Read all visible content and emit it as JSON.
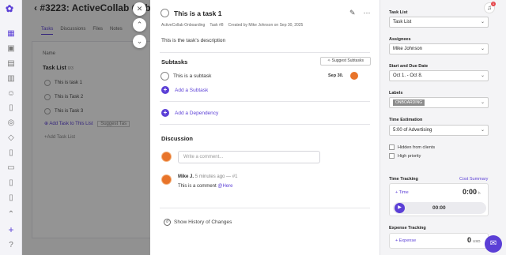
{
  "project": {
    "breadcrumb": "#3223: ActiveCollab Onb",
    "tabs": [
      "Tasks",
      "Discussions",
      "Files",
      "Notes"
    ],
    "list_header": "Name",
    "task_list_title": "Task List",
    "task_list_count": "0/3",
    "tasks": [
      "This is task 1",
      "This is Task 2",
      "This is Task 3"
    ],
    "add_task": "Add Task to This List",
    "suggest": "Suggest Tas",
    "add_task_list": "+Add Task List"
  },
  "task": {
    "title": "This is a task 1",
    "project": "ActiveCollab Onboarding",
    "number": "Task #8",
    "created": "Created by Mike Johnson on Sep 30, 2025",
    "description": "This is the task's description",
    "subtasks_heading": "Subtasks",
    "suggest_subtasks": "Suggest Subtasks",
    "subtask": {
      "label": "This is a subtask",
      "date": "Sep 30."
    },
    "add_subtask": "Add a Subtask",
    "add_dependency": "Add a Dependency",
    "discussion_heading": "Discussion",
    "comment_placeholder": "Write a comment...",
    "comment": {
      "author": "Mike J.",
      "time": "5 minutes ago",
      "number": "#1",
      "text": "This is a comment",
      "mention": "@Here"
    },
    "history": "Show History of Changes"
  },
  "sidebar": {
    "task_list_label": "Task List",
    "task_list_value": "Task List",
    "assignees_label": "Assignees",
    "assignees_value": "Mike Johnson",
    "dates_label": "Start and Due Date",
    "dates_value": "Oct 1. - Oct 8.",
    "labels_label": "Labels",
    "label_value": "ONBOARDING",
    "estimation_label": "Time Estimation",
    "estimation_value": "5:00 of Advertising",
    "hidden_label": "Hidden from clients",
    "priority_label": "High priority",
    "time_tracking_label": "Time Tracking",
    "cost_summary": "Cost Summary",
    "time_link": "Time",
    "time_value": "0:00",
    "time_unit": "h",
    "timer": "00:00",
    "expense_label": "Expense Tracking",
    "expense_link": "Expense",
    "expense_value": "0",
    "expense_unit": "USD",
    "notification_count": "1"
  },
  "colors": {
    "accent": "#5b3fd6",
    "avatar": "#e8742a"
  }
}
